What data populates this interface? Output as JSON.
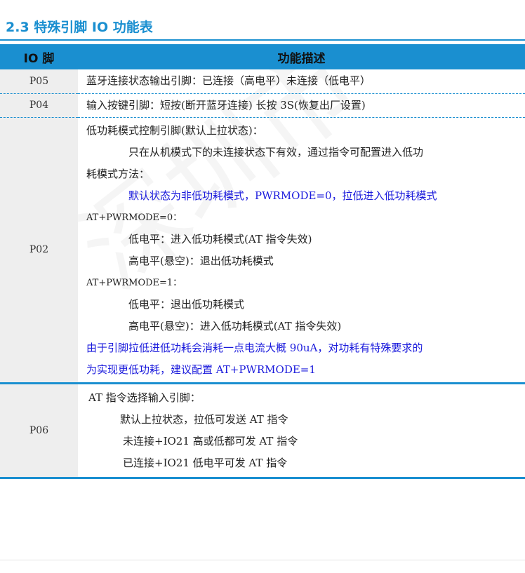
{
  "section_title": "2.3 特殊引脚 IO 功能表",
  "table": {
    "headers": [
      "IO 脚",
      "功能描述"
    ],
    "rows": [
      {
        "pin": "P05",
        "lines": [
          "蓝牙连接状态输出引脚：已连接（高电平）未连接（低电平）"
        ]
      },
      {
        "pin": "P04",
        "lines": [
          "输入按键引脚：短按(断开蓝牙连接) 长按 3S(恢复出厂设置)"
        ]
      },
      {
        "pin": "P02",
        "lines": [
          "低功耗模式控制引脚(默认上拉状态)：",
          "只在从机模式下的未连接状态下有效，通过指令可配置进入低功",
          "耗模式方法：",
          "默认状态为非低功耗模式，PWRMODE=0，拉低进入低功耗模式",
          "AT+PWRMODE=0：",
          "低电平：进入低功耗模式(AT 指令失效)",
          "高电平(悬空)：退出低功耗模式",
          "AT+PWRMODE=1：",
          "低电平：退出低功耗模式",
          "高电平(悬空)：进入低功耗模式(AT 指令失效)",
          "由于引脚拉低进低功耗会消耗一点电流大概 90uA，对功耗有特殊要求的",
          "为实现更低功耗，建议配置 AT+PWRMODE=1"
        ]
      },
      {
        "pin": "P06",
        "lines": [
          "AT 指令选择输入引脚：",
          "默认上拉状态，拉低可发送 AT 指令",
          "未连接+IO21 高或低都可发 AT 指令",
          "已连接+IO21 低电平可发 AT 指令"
        ]
      }
    ]
  }
}
